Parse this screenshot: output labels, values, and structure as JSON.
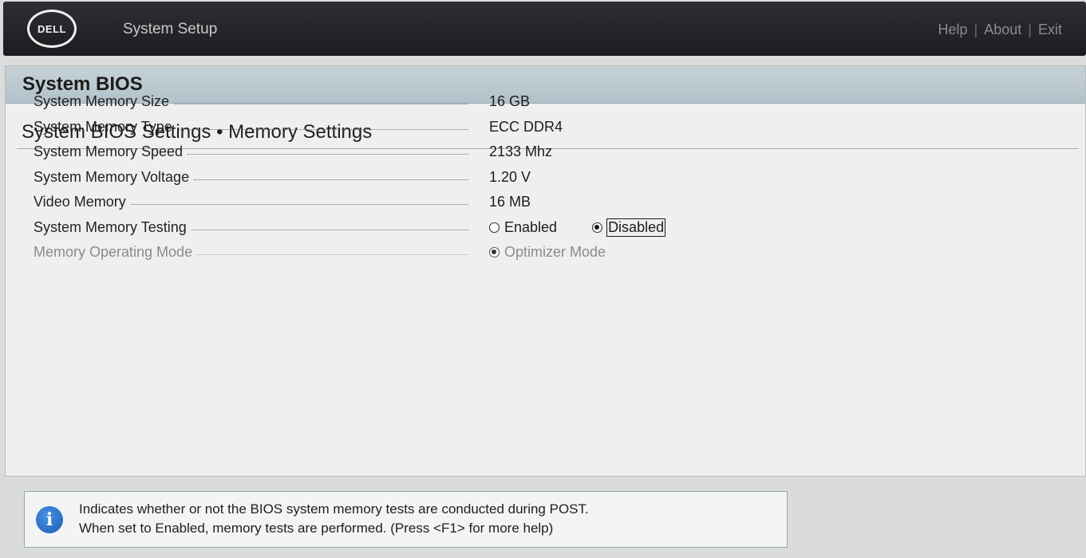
{
  "header": {
    "logo_text": "DELL",
    "app_title": "System Setup",
    "links": [
      "Help",
      "About",
      "Exit"
    ],
    "separator": "|"
  },
  "panel": {
    "title": "System BIOS",
    "section_title": "System BIOS Settings • Memory Settings"
  },
  "settings": [
    {
      "label": "System Memory Size",
      "value": "16 GB"
    },
    {
      "label": "System Memory Type",
      "value": "ECC DDR4"
    },
    {
      "label": "System Memory Speed",
      "value": "2133 Mhz"
    },
    {
      "label": "System Memory Voltage",
      "value": "1.20 V"
    },
    {
      "label": "Video Memory",
      "value": "16 MB"
    },
    {
      "label": "System Memory Testing",
      "options": [
        "Enabled",
        "Disabled"
      ],
      "selected": "Disabled"
    },
    {
      "label": "Memory Operating Mode",
      "options": [
        "Optimizer Mode"
      ],
      "selected": "Optimizer Mode",
      "disabled": true
    }
  ],
  "help": {
    "icon": "info-icon",
    "line1": "Indicates whether or not the BIOS system memory tests are conducted during POST.",
    "line2": "When set to Enabled, memory tests are performed. (Press <F1> for more help)"
  },
  "colors": {
    "header_bg": "#1f2023",
    "panel_head_bg": "#b8c6ce",
    "info_icon": "#2468c4"
  }
}
